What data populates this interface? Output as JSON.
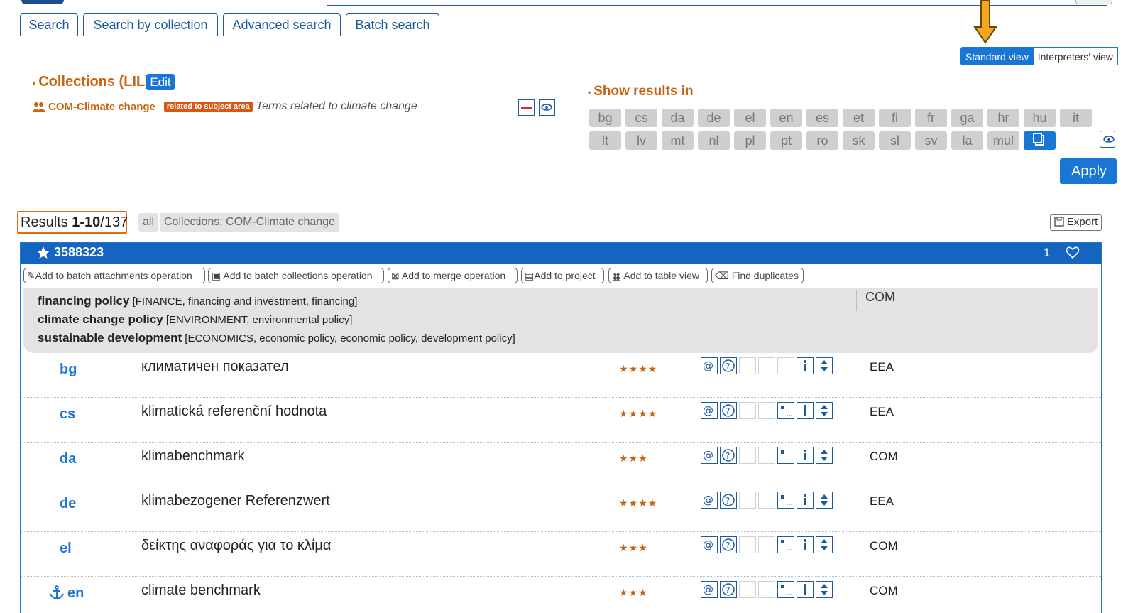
{
  "tabs": [
    "Search",
    "Search by collection",
    "Advanced search",
    "Batch search"
  ],
  "view_switch": {
    "standard": "Standard view",
    "interpreters": "Interpreters' view"
  },
  "collections": {
    "title": "Collections (LIL)",
    "edit_label": "Edit",
    "item": {
      "name": "COM-Climate change",
      "badge": "related to subject area",
      "description": "Terms related to climate change"
    }
  },
  "show_results": {
    "title": "Show results in",
    "languages_row1": [
      "bg",
      "cs",
      "da",
      "de",
      "el",
      "en",
      "es",
      "et",
      "fi",
      "fr",
      "ga",
      "hr",
      "hu",
      "it"
    ],
    "languages_row2": [
      "lt",
      "lv",
      "mt",
      "nl",
      "pl",
      "pt",
      "ro",
      "sk",
      "sl",
      "sv",
      "la",
      "mul"
    ],
    "apply_label": "Apply"
  },
  "results": {
    "prefix": "Results ",
    "range": "1-10",
    "total": "/137",
    "chip_all": "all",
    "chip_collection": "Collections: COM-Climate change",
    "export_label": "Export"
  },
  "entry": {
    "id": "3588323",
    "count": "1",
    "operations": [
      "Add to batch attachments operation",
      "Add to batch collections operation",
      "Add to merge operation",
      "Add to project",
      "Add to table view",
      "Find duplicates"
    ],
    "subjects": [
      {
        "term": "financing policy",
        "path": " [FINANCE, financing and investment, financing]"
      },
      {
        "term": "climate change policy",
        "path": " [ENVIRONMENT, environmental policy]"
      },
      {
        "term": "sustainable development",
        "path": " [ECONOMICS, economic policy, economic policy, development policy]"
      }
    ],
    "subject_source": "COM",
    "terms": [
      {
        "lang": "bg",
        "term": "климатичен показател",
        "reliability": "★★★★",
        "source": "EEA"
      },
      {
        "lang": "cs",
        "term": "klimatická referenční hodnota",
        "reliability": "★★★★",
        "source": "EEA"
      },
      {
        "lang": "da",
        "term": "klimabenchmark",
        "reliability": "★★★",
        "source": "COM"
      },
      {
        "lang": "de",
        "term": "klimabezogener Referenzwert",
        "reliability": "★★★★",
        "source": "EEA"
      },
      {
        "lang": "el",
        "term": "δείκτης αναφοράς για το κλίμα",
        "reliability": "★★★",
        "source": "COM"
      },
      {
        "lang": "en",
        "term": "climate benchmark",
        "reliability": "★★★",
        "source": "COM"
      }
    ]
  }
}
